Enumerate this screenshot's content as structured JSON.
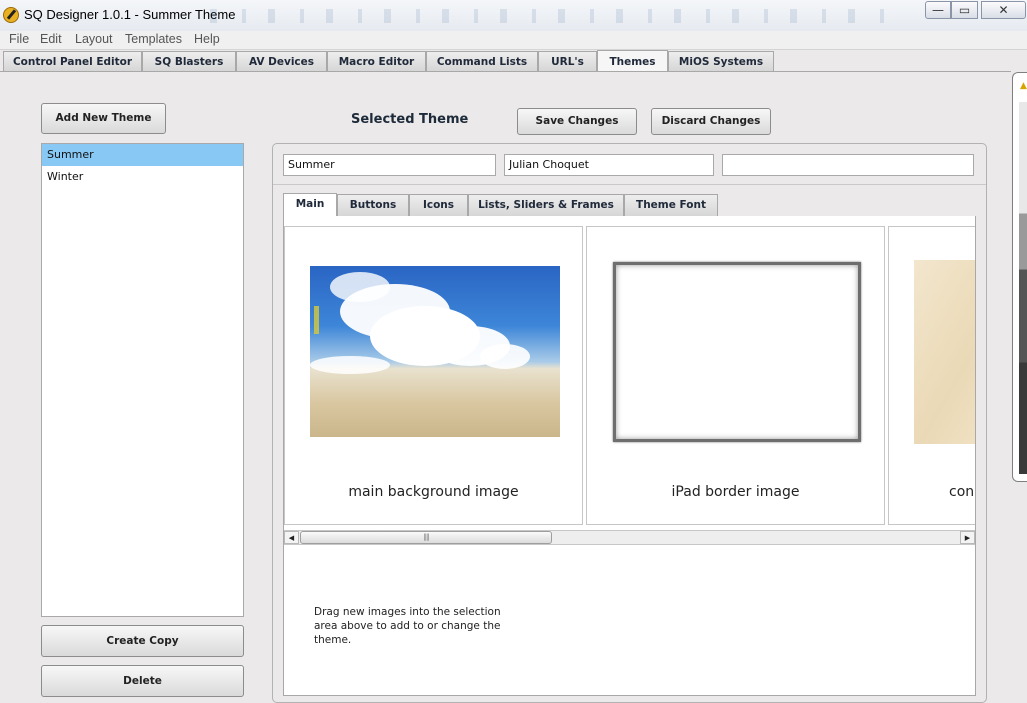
{
  "window": {
    "title": "SQ Designer 1.0.1 - Summer Theme",
    "minimize": "—",
    "maximize": "▭",
    "close": "✕"
  },
  "menu": [
    "File",
    "Edit",
    "Layout",
    "Templates",
    "Help"
  ],
  "main_tabs": [
    "Control Panel Editor",
    "SQ Blasters",
    "AV Devices",
    "Macro Editor",
    "Command Lists",
    "URL's",
    "Themes",
    "MiOS Systems"
  ],
  "main_tabs_active": "Themes",
  "left_panel": {
    "add_button": "Add New Theme",
    "themes": [
      "Summer",
      "Winter"
    ],
    "selected_theme": "Summer",
    "create_copy_button": "Create Copy",
    "delete_button": "Delete"
  },
  "header": {
    "label": "Selected Theme",
    "save_button": "Save Changes",
    "discard_button": "Discard Changes"
  },
  "fields": {
    "theme_name": "Summer",
    "author": "Julian Choquet",
    "third": ""
  },
  "sub_tabs": [
    "Main",
    "Buttons",
    "Icons",
    "Lists, Sliders & Frames",
    "Theme Font"
  ],
  "sub_tabs_active": "Main",
  "images": {
    "main_background": "main background image",
    "ipad_border": "iPad border image",
    "third_partial": "con"
  },
  "scroll": {
    "left_arrow": "◀",
    "right_arrow": "▶",
    "thumb_grip": "||||"
  },
  "drag_hint": "Drag new images into the selection area above to add to or change the theme.",
  "icons": {
    "app": "pencil-app-icon",
    "minimize": "minimize-icon",
    "maximize": "maximize-icon",
    "close": "close-icon",
    "warning": "warning-icon"
  },
  "colors": {
    "selection": "#88c8f5",
    "background": "#ebe9e9"
  }
}
